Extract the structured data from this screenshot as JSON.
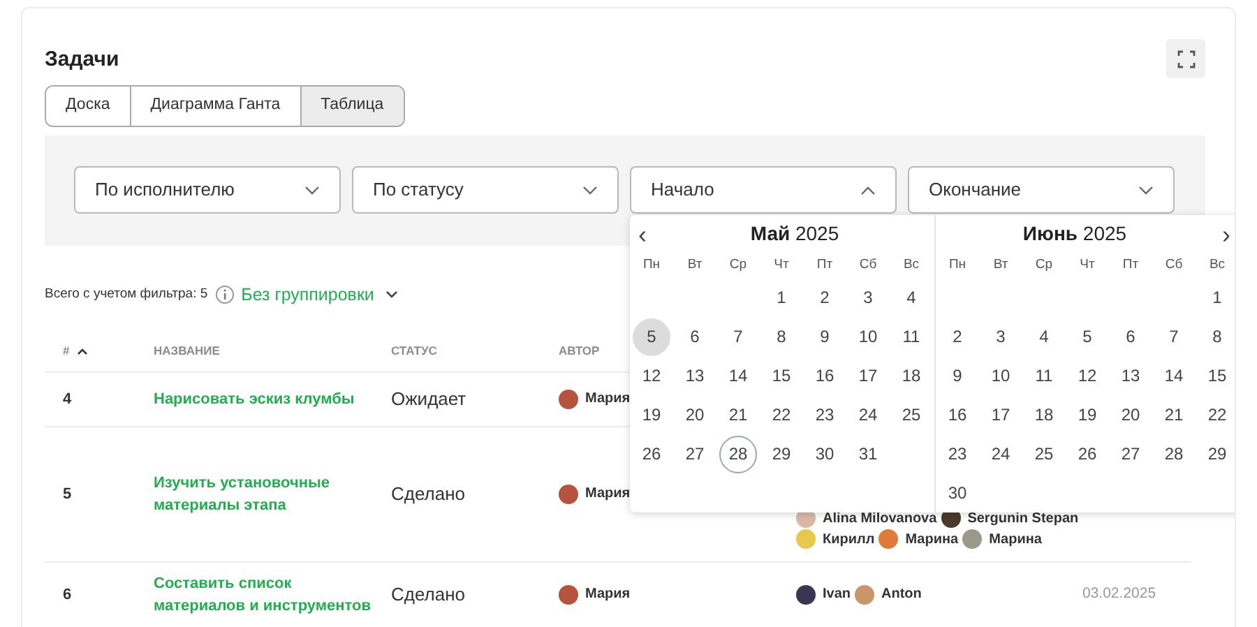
{
  "title": "Задачи",
  "view_tabs": [
    {
      "label": "Доска",
      "selected": false
    },
    {
      "label": "Диаграмма Ганта",
      "selected": false
    },
    {
      "label": "Таблица",
      "selected": true
    }
  ],
  "filters": [
    {
      "label": "По исполнителю",
      "expanded": false
    },
    {
      "label": "По статусу",
      "expanded": false
    },
    {
      "label": "Начало",
      "expanded": true
    },
    {
      "label": "Окончание",
      "expanded": false
    }
  ],
  "calendar": {
    "prev": "‹",
    "next": "›",
    "months": [
      {
        "title": "**Май** 2025",
        "weekdays": [
          "Пн",
          "Вт",
          "Ср",
          "Чт",
          "Пт",
          "Сб",
          "Вс"
        ],
        "weeks": [
          [
            {
              "day": "1",
              "hovered": false,
              "today": false
            },
            {
              "day": "2",
              "hovered": false,
              "today": false
            },
            {
              "day": "3",
              "hovered": false,
              "today": false
            },
            {
              "day": "4",
              "hovered": false,
              "today": false
            }
          ],
          [
            {
              "day": "5",
              "hovered": true,
              "today": false
            },
            {
              "day": "6",
              "hovered": false,
              "today": false
            },
            {
              "day": "7",
              "hovered": false,
              "today": false
            },
            {
              "day": "8",
              "hovered": false,
              "today": false
            },
            {
              "day": "9",
              "hovered": false,
              "today": false
            },
            {
              "day": "10",
              "hovered": false,
              "today": false
            },
            {
              "day": "11",
              "hovered": false,
              "today": false
            }
          ],
          [
            {
              "day": "12",
              "hovered": false,
              "today": false
            },
            {
              "day": "13",
              "hovered": false,
              "today": false
            },
            {
              "day": "14",
              "hovered": false,
              "today": false
            },
            {
              "day": "15",
              "hovered": false,
              "today": false
            },
            {
              "day": "16",
              "hovered": false,
              "today": false
            },
            {
              "day": "17",
              "hovered": false,
              "today": false
            },
            {
              "day": "18",
              "hovered": false,
              "today": false
            }
          ],
          [
            {
              "day": "19",
              "hovered": false,
              "today": false
            },
            {
              "day": "20",
              "hovered": false,
              "today": false
            },
            {
              "day": "21",
              "hovered": false,
              "today": false
            },
            {
              "day": "22",
              "hovered": false,
              "today": false
            },
            {
              "day": "23",
              "hovered": false,
              "today": false
            },
            {
              "day": "24",
              "hovered": false,
              "today": false
            },
            {
              "day": "25",
              "hovered": false,
              "today": false
            }
          ],
          [
            {
              "day": "26",
              "hovered": false,
              "today": false
            },
            {
              "day": "27",
              "hovered": false,
              "today": false
            },
            {
              "day": "28",
              "hovered": false,
              "today": true
            },
            {
              "day": "29",
              "hovered": false,
              "today": false
            },
            {
              "day": "30",
              "hovered": false,
              "today": false
            },
            {
              "day": "31",
              "hovered": false,
              "today": false
            }
          ]
        ]
      },
      {
        "title": "**Июнь** 2025",
        "weekdays": [
          "Пн",
          "Вт",
          "Ср",
          "Чт",
          "Пт",
          "Сб",
          "Вс"
        ],
        "weeks": [
          [
            {
              "day": "1",
              "hovered": false,
              "today": false
            }
          ],
          [
            {
              "day": "2",
              "hovered": false,
              "today": false
            },
            {
              "day": "3",
              "hovered": false,
              "today": false
            },
            {
              "day": "4",
              "hovered": false,
              "today": false
            },
            {
              "day": "5",
              "hovered": false,
              "today": false
            },
            {
              "day": "6",
              "hovered": false,
              "today": false
            },
            {
              "day": "7",
              "hovered": false,
              "today": false
            },
            {
              "day": "8",
              "hovered": false,
              "today": false
            }
          ],
          [
            {
              "day": "9",
              "hovered": false,
              "today": false
            },
            {
              "day": "10",
              "hovered": false,
              "today": false
            },
            {
              "day": "11",
              "hovered": false,
              "today": false
            },
            {
              "day": "12",
              "hovered": false,
              "today": false
            },
            {
              "day": "13",
              "hovered": false,
              "today": false
            },
            {
              "day": "14",
              "hovered": false,
              "today": false
            },
            {
              "day": "15",
              "hovered": false,
              "today": false
            }
          ],
          [
            {
              "day": "16",
              "hovered": false,
              "today": false
            },
            {
              "day": "17",
              "hovered": false,
              "today": false
            },
            {
              "day": "18",
              "hovered": false,
              "today": false
            },
            {
              "day": "19",
              "hovered": false,
              "today": false
            },
            {
              "day": "20",
              "hovered": false,
              "today": false
            },
            {
              "day": "21",
              "hovered": false,
              "today": false
            },
            {
              "day": "22",
              "hovered": false,
              "today": false
            }
          ],
          [
            {
              "day": "23",
              "hovered": false,
              "today": false
            },
            {
              "day": "24",
              "hovered": false,
              "today": false
            },
            {
              "day": "25",
              "hovered": false,
              "today": false
            },
            {
              "day": "26",
              "hovered": false,
              "today": false
            },
            {
              "day": "27",
              "hovered": false,
              "today": false
            },
            {
              "day": "28",
              "hovered": false,
              "today": false
            },
            {
              "day": "29",
              "hovered": false,
              "today": false
            }
          ],
          [
            {
              "day": "30",
              "hovered": false,
              "today": false
            }
          ]
        ]
      }
    ]
  },
  "summary": {
    "count": "Всего с учетом фильтра: 5",
    "grouping": "Без группировки"
  },
  "table": {
    "columns": [
      "#",
      "НАЗВАНИЕ",
      "СТАТУС",
      "АВТОР"
    ],
    "rows": [
      {
        "num": "4",
        "name": "Нарисовать эскиз клумбы",
        "status": "Ожидает",
        "author": {
          "name": "Мария",
          "color": "#b5533c"
        },
        "assignees": []
      },
      {
        "num": "5",
        "name": "Изучить установочные материалы этапа",
        "status": "Сделано",
        "author": {
          "name": "Мария",
          "color": "#b5533c"
        },
        "assignees": [
          [
            {
              "name": "Alina Milovanova",
              "color": "#d9b8a8"
            },
            {
              "name": "Sergunin Stepan",
              "color": "#4a3a2a"
            }
          ],
          [
            {
              "name": "Кирилл",
              "color": "#e8c84a"
            },
            {
              "name": "Марина",
              "color": "#e07a3a"
            },
            {
              "name": "Марина",
              "color": "#9a9a8a"
            }
          ]
        ]
      },
      {
        "num": "6",
        "name": "Составить список материалов и инструментов",
        "status": "Сделано",
        "author": {
          "name": "Мария",
          "color": "#b5533c"
        },
        "assignees": [
          [
            {
              "name": "Ivan",
              "color": "#3a3550"
            },
            {
              "name": "Anton",
              "color": "#c9956a"
            }
          ]
        ],
        "date": "03.02.2025"
      }
    ]
  }
}
